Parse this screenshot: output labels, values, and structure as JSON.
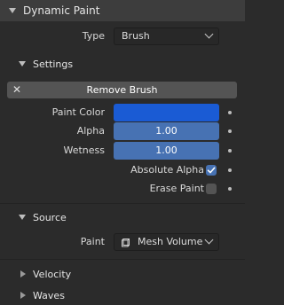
{
  "panel": {
    "title": "Dynamic Paint"
  },
  "type_field": {
    "label": "Type",
    "value": "Brush"
  },
  "settings": {
    "title": "Settings",
    "remove_button": "Remove Brush",
    "paint_color": {
      "label": "Paint Color",
      "color": "#1a5bd4"
    },
    "alpha": {
      "label": "Alpha",
      "value": "1.00"
    },
    "wetness": {
      "label": "Wetness",
      "value": "1.00"
    },
    "absolute_alpha": {
      "label": "Absolute Alpha",
      "checked": true
    },
    "erase_paint": {
      "label": "Erase Paint",
      "checked": false
    }
  },
  "source": {
    "title": "Source",
    "paint": {
      "label": "Paint",
      "value": "Mesh Volume",
      "icon": "mesh-volume-icon"
    }
  },
  "velocity": {
    "title": "Velocity"
  },
  "waves": {
    "title": "Waves"
  }
}
